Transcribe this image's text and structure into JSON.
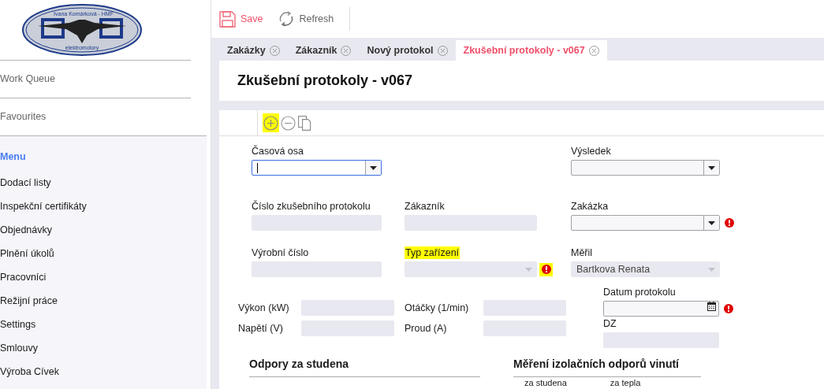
{
  "logo": {
    "top_text": "Ivana Komárková - HMF",
    "bottom_text": "elektromotory"
  },
  "sidebar": {
    "items": [
      {
        "label": "Work Queue"
      },
      {
        "label": "Favourites"
      }
    ],
    "menu": {
      "title": "Menu",
      "items": [
        {
          "label": "Dodací listy"
        },
        {
          "label": "Inspekční certifikáty"
        },
        {
          "label": "Objednávky"
        },
        {
          "label": "Plnění úkolů"
        },
        {
          "label": "Pracovníci"
        },
        {
          "label": "Režijní práce"
        },
        {
          "label": "Settings"
        },
        {
          "label": "Smlouvy"
        },
        {
          "label": "Výroba Cívek"
        }
      ]
    }
  },
  "toolbar": [
    {
      "kind": "save",
      "label": "Save"
    },
    {
      "kind": "refresh",
      "label": "Refresh"
    }
  ],
  "tabs": [
    {
      "label": "Zakázky",
      "selected": false
    },
    {
      "label": "Zákazník",
      "selected": false
    },
    {
      "label": "Nový protokol",
      "selected": false
    },
    {
      "label": "Zkušební protokoly - v067",
      "selected": true
    }
  ],
  "page_title": "Zkušební protokoly - v067",
  "actions": [
    {
      "kind": "add",
      "highlighted": true
    },
    {
      "kind": "remove",
      "highlighted": false
    },
    {
      "kind": "copy",
      "highlighted": false
    }
  ],
  "fields": {
    "time_axis": {
      "label": "Časová osa",
      "kind": "select",
      "focused": true,
      "disabled": false
    },
    "result": {
      "label": "Výsledek",
      "kind": "select",
      "focused": false,
      "disabled": false
    },
    "protocol_number": {
      "label": "Číslo zkušebního protokolu",
      "kind": "text",
      "disabled": true
    },
    "customer": {
      "label": "Zákazník",
      "kind": "text",
      "disabled": true
    },
    "order": {
      "label": "Zakázka",
      "kind": "select",
      "focused": false,
      "disabled": false,
      "required": true
    },
    "serial_number": {
      "label": "Výrobní číslo",
      "kind": "text",
      "disabled": true
    },
    "device_type": {
      "label": "Typ zařízení",
      "kind": "select",
      "disabled": true,
      "required": true,
      "highlighted": true
    },
    "measured_by": {
      "label": "Měřil",
      "kind": "select",
      "disabled": true,
      "value": "Bartkova Renata"
    },
    "power": {
      "label": "Výkon (kW)",
      "kind": "text",
      "disabled": true
    },
    "speed": {
      "label": "Otáčky (1/min)",
      "kind": "text",
      "disabled": true
    },
    "voltage": {
      "label": "Napětí (V)",
      "kind": "text",
      "disabled": true
    },
    "current": {
      "label": "Proud (A)",
      "kind": "text",
      "disabled": true
    },
    "date": {
      "label": "Datum protokolu",
      "kind": "date",
      "focused": false,
      "disabled": false,
      "required": true
    },
    "dz": {
      "label": "DZ",
      "kind": "text",
      "disabled": true
    }
  },
  "sections": [
    {
      "title": "Odpory za studena"
    },
    {
      "title": "Měření izolačních odporů vinutí",
      "columns": [
        "za studena",
        "za tepla"
      ]
    }
  ]
}
